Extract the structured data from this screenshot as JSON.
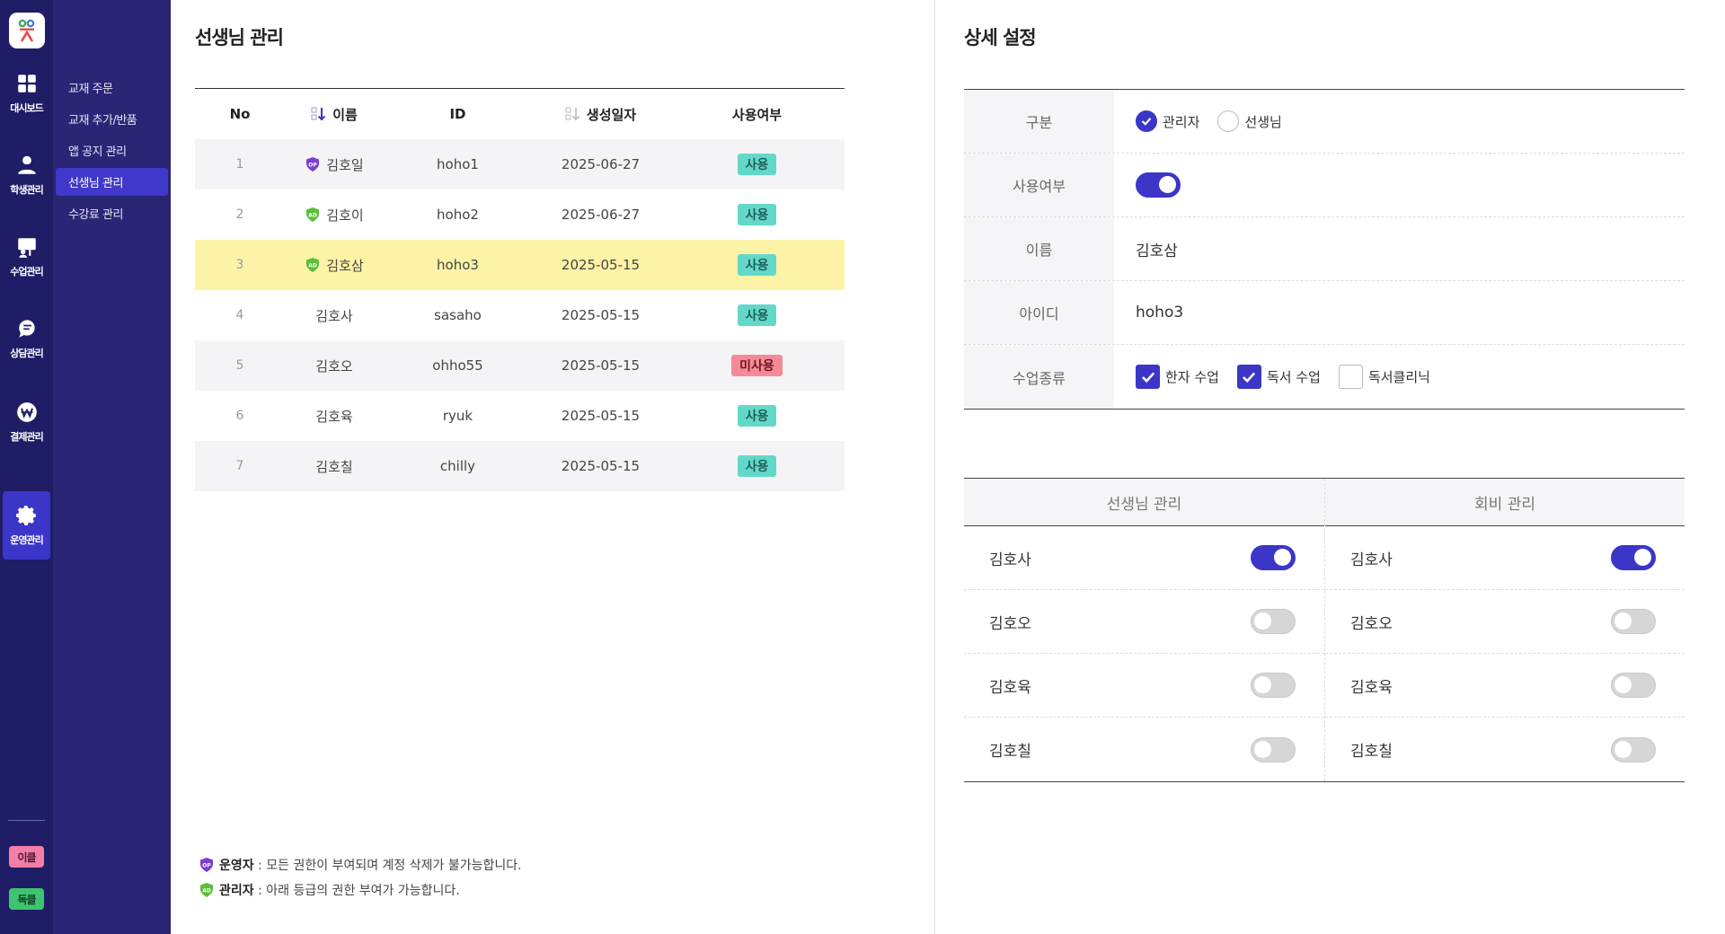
{
  "rail": {
    "items": [
      {
        "label": "대시보드",
        "icon": "dashboard-icon"
      },
      {
        "label": "학생관리",
        "icon": "student-icon"
      },
      {
        "label": "수업관리",
        "icon": "class-icon"
      },
      {
        "label": "상담관리",
        "icon": "chat-icon"
      },
      {
        "label": "결제관리",
        "icon": "won-icon"
      },
      {
        "label": "운영관리",
        "icon": "gear-icon",
        "active": true
      }
    ],
    "badges": [
      "이클",
      "독클"
    ]
  },
  "subnav": {
    "items": [
      "교재 주문",
      "교재 추가/반품",
      "앱 공지 관리",
      "선생님 관리",
      "수강료 관리"
    ],
    "active": "선생님 관리"
  },
  "main": {
    "title": "선생님 관리",
    "columns": {
      "no": "No",
      "name": "이름",
      "id": "ID",
      "date": "생성일자",
      "use": "사용여부"
    },
    "rows": [
      {
        "no": "1",
        "role": "OP",
        "name": "김호일",
        "id": "hoho1",
        "date": "2025-06-27",
        "use": "사용"
      },
      {
        "no": "2",
        "role": "AD",
        "name": "김호이",
        "id": "hoho2",
        "date": "2025-06-27",
        "use": "사용"
      },
      {
        "no": "3",
        "role": "AD",
        "name": "김호삼",
        "id": "hoho3",
        "date": "2025-05-15",
        "use": "사용"
      },
      {
        "no": "4",
        "role": "",
        "name": "김호사",
        "id": "sasaho",
        "date": "2025-05-15",
        "use": "사용"
      },
      {
        "no": "5",
        "role": "",
        "name": "김호오",
        "id": "ohho55",
        "date": "2025-05-15",
        "use": "미사용"
      },
      {
        "no": "6",
        "role": "",
        "name": "김호육",
        "id": "ryuk",
        "date": "2025-05-15",
        "use": "사용"
      },
      {
        "no": "7",
        "role": "",
        "name": "김호칠",
        "id": "chilly",
        "date": "2025-05-15",
        "use": "사용"
      }
    ],
    "selected_row": "3",
    "legend": {
      "op_title": "운영자",
      "op_text": " : 모든 권한이 부여되며 계정 삭제가 불가능합니다.",
      "ad_title": "관리자",
      "ad_text": " : 아래 등급의 권한 부여가 가능합니다."
    }
  },
  "detail": {
    "title": "상세 설정",
    "labels": {
      "type": "구분",
      "use": "사용여부",
      "name": "이름",
      "userid": "아이디",
      "classes": "수업종류"
    },
    "type_options": [
      {
        "label": "관리자",
        "checked": true
      },
      {
        "label": "선생님",
        "checked": false
      }
    ],
    "use_on": true,
    "name_value": "김호삼",
    "userid_value": "hoho3",
    "class_options": [
      {
        "label": "한자 수업",
        "checked": true
      },
      {
        "label": "독서 수업",
        "checked": true
      },
      {
        "label": "독서클리닉",
        "checked": false
      }
    ],
    "perm": {
      "col1_title": "선생님 관리",
      "col2_title": "회비 관리",
      "rows": [
        {
          "name": "김호사",
          "col1": true,
          "col2": true
        },
        {
          "name": "김호오",
          "col1": false,
          "col2": false
        },
        {
          "name": "김호육",
          "col1": false,
          "col2": false
        },
        {
          "name": "김호칠",
          "col1": false,
          "col2": false
        }
      ]
    }
  },
  "colors": {
    "rail_bg": "#1f1d66",
    "subnav_bg": "#2a2575",
    "accent": "#3b36c8",
    "selected_row": "#fdf3a6",
    "badge_on": "#63d8c9",
    "badge_off": "#f58a96",
    "op_icon": "#7b3fd1",
    "ad_icon": "#5bbf3a"
  }
}
